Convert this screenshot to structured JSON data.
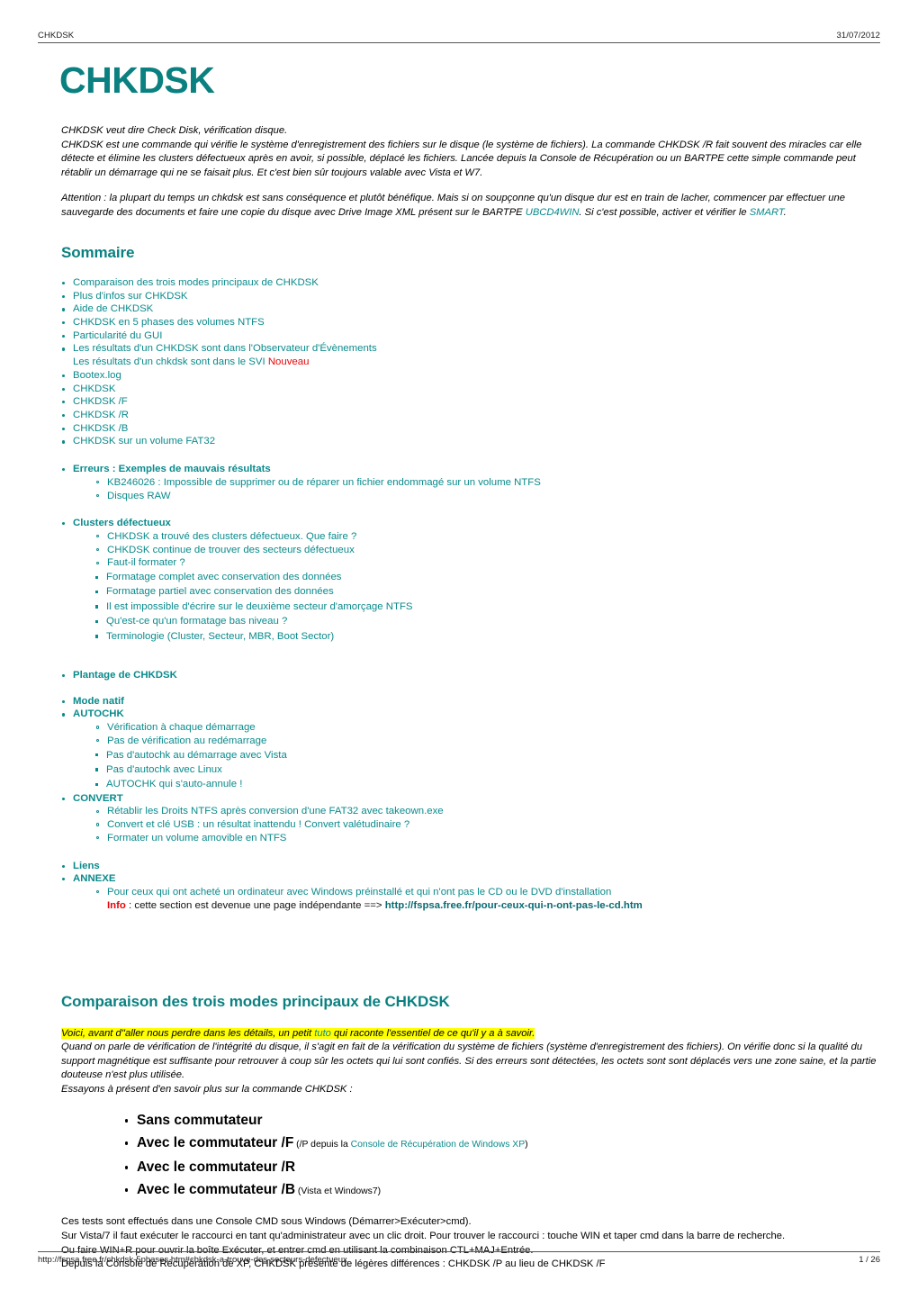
{
  "header": {
    "left": "CHKDSK",
    "right": "31/07/2012"
  },
  "footer": {
    "url": "http://fspsa.free.fr/chkdsk-5phases.htm#chkdsk-a-trouve-des-secteurs-defectueux",
    "page": "1 / 26"
  },
  "title": "CHKDSK",
  "intro": {
    "line1": "CHKDSK veut dire Check Disk, vérification disque.",
    "line2": "CHKDSK est une commande qui vérifie le système d'enregistrement des fichiers sur le disque (le système de fichiers). La commande CHKDSK /R fait souvent des miracles car elle détecte et élimine les clusters défectueux après en avoir, si possible, déplacé les fichiers. Lancée depuis la Console de Récupération ou un BARTPE cette simple commande peut rétablir un démarrage qui ne se faisait plus. Et c'est bien sûr toujours valable avec Vista et W7.",
    "warn_a": "Attention : la plupart du temps un chkdsk est sans conséquence et plutôt bénéfique. Mais si on soupçonne qu'un disque dur est en train de lacher, commencer par effectuer une sauvegarde des documents et faire une copie du disque avec Drive Image XML présent sur le BARTPE ",
    "warn_link1": "UBCD4WIN",
    "warn_b": ". Si c'est possible, activer et vérifier le ",
    "warn_link2": "SMART",
    "warn_c": "."
  },
  "sommaire": {
    "heading": "Sommaire",
    "items": [
      "Comparaison des trois modes principaux de CHKDSK",
      "Plus d'infos sur CHKDSK",
      "Aide de CHKDSK",
      "CHKDSK en 5 phases des volumes NTFS",
      "Particularité du GUI",
      "Les résultats d'un CHKDSK sont dans l'Observateur d'Évènements"
    ],
    "svi_line": "Les résultats d'un chkdsk sont dans le SVI ",
    "svi_badge": "Nouveau",
    "items2": [
      "Bootex.log",
      "CHKDSK",
      "CHKDSK /F",
      "CHKDSK /R",
      "CHKDSK /B",
      "CHKDSK sur un volume FAT32"
    ],
    "erreurs": {
      "label": "Erreurs : Exemples de mauvais résultats",
      "children": [
        "KB246026 : Impossible de supprimer ou de réparer un fichier endommagé sur un volume NTFS",
        "Disques RAW"
      ]
    },
    "clusters": {
      "label": "Clusters défectueux",
      "children": [
        "CHKDSK a trouvé des clusters défectueux. Que faire ?",
        "CHKDSK continue de trouver des secteurs défectueux",
        "Faut-il formater ?"
      ],
      "grandchildren": [
        "Formatage complet avec conservation des données",
        "Formatage partiel avec conservation des données",
        "Il est impossible d'écrire sur le deuxième secteur d'amorçage NTFS",
        "Qu'est-ce qu'un formatage bas niveau ?",
        "Terminologie (Cluster, Secteur, MBR, Boot Sector)"
      ]
    },
    "plantage": "Plantage de CHKDSK",
    "mode_natif": "Mode natif",
    "autochk": {
      "label": "AUTOCHK",
      "children": [
        "Vérification à chaque démarrage",
        "Pas de vérification au redémarrage"
      ],
      "grandchildren": [
        "Pas d'autochk au démarrage avec Vista",
        "Pas d'autochk avec Linux",
        "AUTOCHK qui s'auto-annule !"
      ]
    },
    "convert": {
      "label": "CONVERT",
      "children": [
        "Rétablir les Droits NTFS après conversion d'une FAT32 avec takeown.exe",
        "Convert et clé USB : un résultat inattendu ! Convert valétudinaire ?",
        "Formater un volume amovible en NTFS"
      ]
    },
    "liens": "Liens",
    "annexe": {
      "label": "ANNEXE",
      "child": "Pour ceux qui ont acheté un ordinateur avec Windows préinstallé et qui n'ont pas le CD ou le DVD d'installation",
      "info_badge": "Info",
      "info_text": " : cette section est devenue une page indépendante ==> ",
      "info_url": "http://fspsa.free.fr/pour-ceux-qui-n-ont-pas-le-cd.htm"
    }
  },
  "comparaison": {
    "heading": "Comparaison des trois modes principaux de CHKDSK",
    "highlight_a": "Voici, avant d''aller nous perdre dans les détails, un petit ",
    "highlight_tuto": "tuto",
    "highlight_b": " qui raconte l'essentiel de ce qu'il y a à savoir.",
    "para": "Quand on parle de vérification de l'intégrité du disque, il s'agit en fait de la vérification du système de fichiers (système d'enregistrement des fichiers). On vérifie donc si la qualité du support magnétique est suffisante pour retrouver à coup sûr les octets qui lui sont confiés. Si des erreurs sont détectées, les octets sont sont déplacés vers une zone saine, et la partie douteuse n'est plus utilisée.",
    "para2": "Essayons à présent d'en savoir plus sur la commande CHKDSK :",
    "modes": [
      {
        "label": "Sans commutateur",
        "note": "",
        "note_teal": "",
        "note_tail": ""
      },
      {
        "label": "Avec le commutateur /F",
        "note": " (/P depuis la ",
        "note_teal": "Console de Récupération de Windows XP",
        "note_tail": ")"
      },
      {
        "label": "Avec le commutateur /R",
        "note": "",
        "note_teal": "",
        "note_tail": ""
      },
      {
        "label": "Avec le commutateur /B",
        "note": " (Vista et Windows7)",
        "note_teal": "",
        "note_tail": ""
      }
    ],
    "tail": [
      "Ces tests sont effectués dans une Console CMD sous Windows (Démarrer>Exécuter>cmd).",
      "Sur Vista/7 il faut exécuter le raccourci en tant qu'administrateur avec un clic droit. Pour trouver le raccourci : touche WIN et taper cmd dans la barre de recherche.",
      "Ou faire WIN+R pour ouvrir la boîte Exécuter, et entrer cmd en utilisant la combinaison CTL+MAJ+Entrée.",
      "Depuis la Console de Récupération de XP, CHKDSK présente de légères différences : CHKDSK /P au lieu de CHKDSK /F"
    ]
  },
  "colors": {
    "teal": "#0a8080",
    "link_teal": "#0a8a8c",
    "red": "#e8050a",
    "highlight": "#ffff00"
  }
}
